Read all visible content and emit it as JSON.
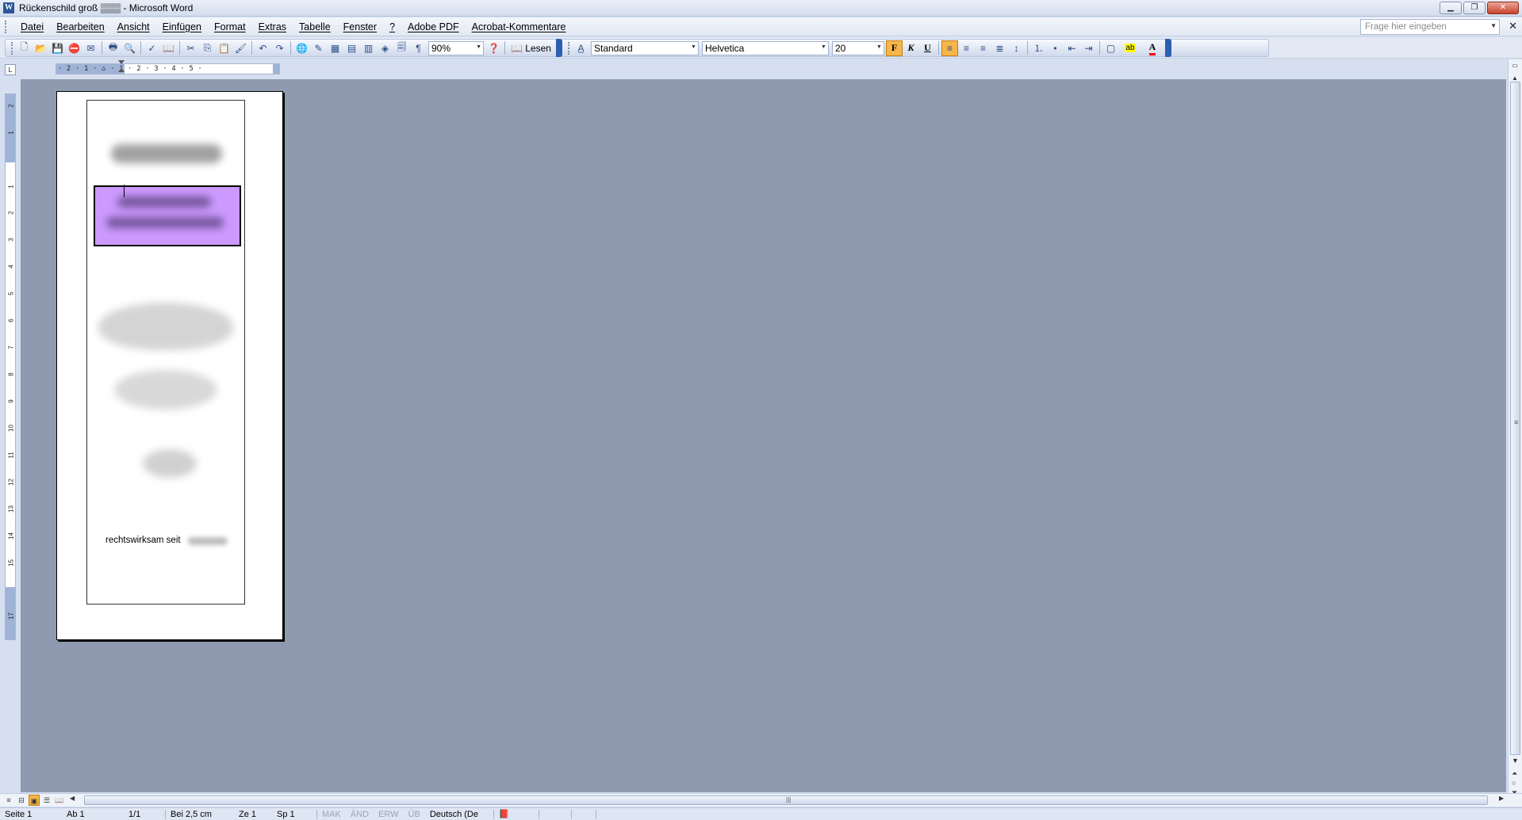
{
  "window": {
    "title": "Rückenschild groß ▒▒▒ - Microsoft Word",
    "controls": [
      "minimize",
      "restore",
      "close"
    ]
  },
  "menu": {
    "items": [
      "Datei",
      "Bearbeiten",
      "Ansicht",
      "Einfügen",
      "Format",
      "Extras",
      "Tabelle",
      "Fenster",
      "?",
      "Adobe PDF",
      "Acrobat-Kommentare"
    ],
    "help_placeholder": "Frage hier eingeben"
  },
  "toolbar": {
    "zoom": "90%",
    "read_label": "Lesen",
    "style": "Standard",
    "font": "Helvetica",
    "size": "20",
    "bold": "F",
    "italic": "K",
    "underline": "U",
    "font_color_letter": "A",
    "highlight_letters": "ab"
  },
  "ruler": {
    "scale": "· 2 · 1 · ⌂ · 1 · 2 · 3 · 4 · 5 ·",
    "vertical_numbers": [
      "2",
      "1",
      "1",
      "2",
      "3",
      "4",
      "5",
      "6",
      "7",
      "8",
      "9",
      "10",
      "11",
      "12",
      "13",
      "14",
      "15",
      "17"
    ]
  },
  "document": {
    "footer_text": "rechtswirksam seit"
  },
  "statusbar": {
    "page": "Seite 1",
    "section": "Ab 1",
    "pages": "1/1",
    "position": "Bei 2,5 cm",
    "line": "Ze 1",
    "column": "Sp 1",
    "mak": "MAK",
    "aend": "ÄND",
    "erw": "ERW",
    "ueb": "ÜB",
    "language": "Deutsch (De"
  }
}
